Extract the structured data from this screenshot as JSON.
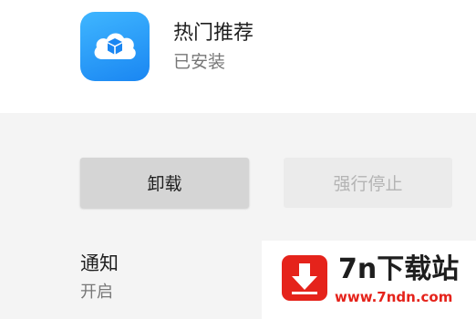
{
  "app": {
    "name": "热门推荐",
    "status": "已安装"
  },
  "actions": {
    "uninstall_label": "卸载",
    "force_stop_label": "强行停止"
  },
  "notification": {
    "title": "通知",
    "status": "开启"
  },
  "watermark": {
    "title": "7n下载站",
    "url": "www.7ndn.com"
  },
  "colors": {
    "icon_gradient_start": "#3fb6ff",
    "icon_gradient_end": "#1a86f2",
    "watermark_red": "#e5231b"
  },
  "icons": [
    "cloud-box-icon",
    "download-arrow-icon"
  ]
}
